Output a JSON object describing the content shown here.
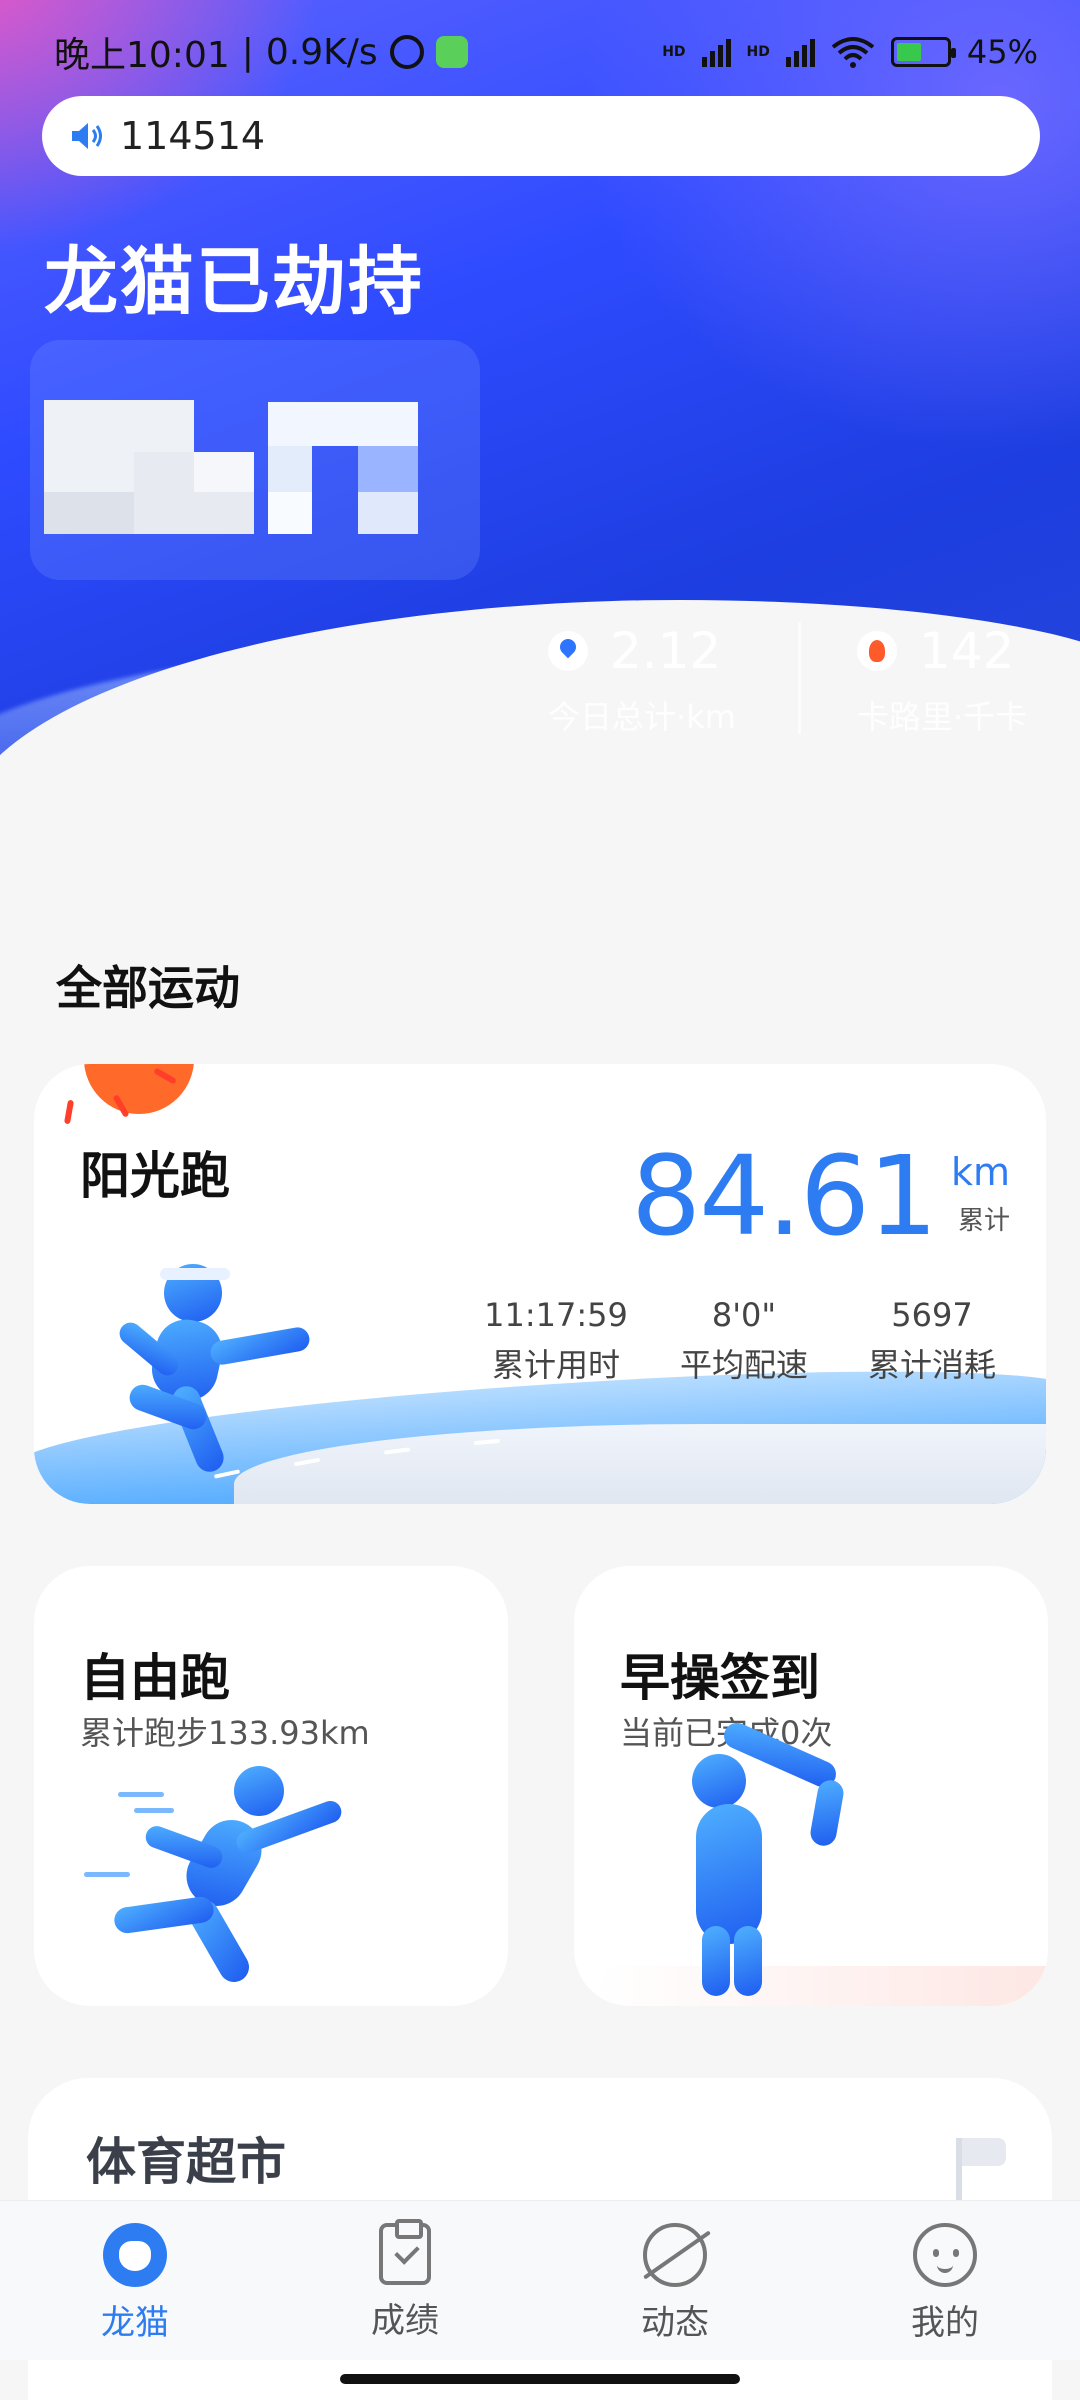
{
  "status_bar": {
    "time": "晚上10:01",
    "separator": "|",
    "net_speed": "0.9K/s",
    "network_label_1": "HD",
    "network_label_2": "HD",
    "battery": "45%"
  },
  "search": {
    "text": "114514"
  },
  "hero": {
    "title": "龙猫已劫持",
    "stats": [
      {
        "value": "2.12",
        "label": "今日总计·km",
        "icon": "location-pin-icon"
      },
      {
        "value": "142",
        "label": "卡路里·千卡",
        "icon": "fire-icon"
      }
    ]
  },
  "section": {
    "title": "全部运动"
  },
  "sunny_run": {
    "title": "阳光跑",
    "distance": "84.61",
    "unit": "km",
    "unit_sub": "累计",
    "stats": [
      {
        "value": "11:17:59",
        "label": "累计用时"
      },
      {
        "value": "8'0\"",
        "label": "平均配速"
      },
      {
        "value": "5697",
        "label": "累计消耗"
      }
    ]
  },
  "free_run": {
    "title": "自由跑",
    "subtitle": "累计跑步133.93km"
  },
  "morning": {
    "title": "早操签到",
    "subtitle": "当前已完成0次"
  },
  "market": {
    "title": "体育超市"
  },
  "bottom_nav": [
    {
      "label": "龙猫",
      "icon": "cat-avatar-icon",
      "active": true
    },
    {
      "label": "成绩",
      "icon": "clipboard-check-icon",
      "active": false
    },
    {
      "label": "动态",
      "icon": "planet-icon",
      "active": false
    },
    {
      "label": "我的",
      "icon": "face-icon",
      "active": false
    }
  ],
  "colors": {
    "accent": "#2d7cf2",
    "hero_blue": "#2f4bff",
    "sun": "#ff6a2a"
  }
}
